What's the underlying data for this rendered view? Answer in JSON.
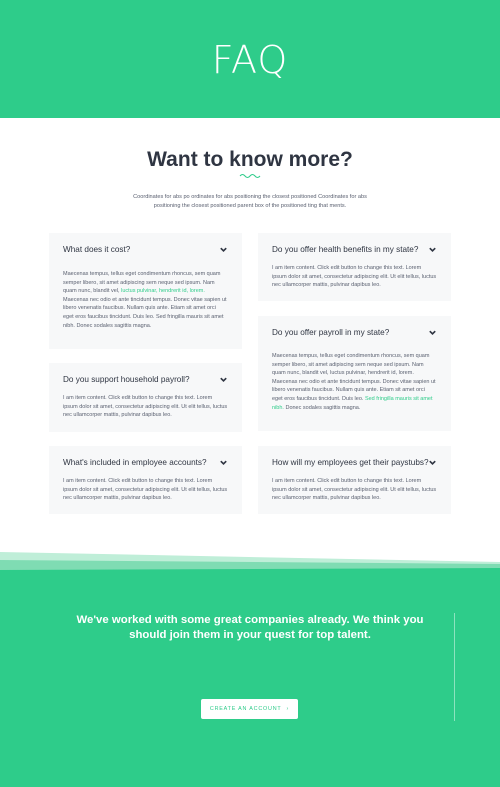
{
  "hero": {
    "title": "FAQ"
  },
  "intro": {
    "heading": "Want to know more?",
    "text": "Coordinates for abs po ordinates for abs positioning the closest positioned Coordinates for abs positioning the closest positioned parent box of the positioned ting that ments."
  },
  "faqs": [
    {
      "question": "What does it cost?",
      "text_before_link": "Maecenas tempus, tellus eget condimentum rhoncus, sem quam semper libero, sit amet adipiscing sem neque sed ipsum. Nam quam nunc, blandit vel, ",
      "link": "luctus pulvinar, hendrerit id, lorem.",
      "text_after_link": " Maecenas nec odio et ante tincidunt tempus. Donec vitae sapien ut libero venenatis faucibus. Nullam quis ante. Etiam sit amet orci eget eros faucibus tincidunt. Duis leo. Sed fringilla mauris sit amet nibh. Donec sodales sagittis magna."
    },
    {
      "question": "Do you offer health benefits in my state?",
      "text_before_link": "I am item content. Click edit button to change this text. Lorem ipsum dolor sit amet, consectetur adipiscing elit. Ut elit tellus, luctus nec ullamcorper mattis, pulvinar dapibus leo.",
      "link": "",
      "text_after_link": ""
    },
    {
      "question": "Do you offer payroll in my state?",
      "text_before_link": "Maecenas tempus, tellus eget condimentum rhoncus, sem quam semper libero, sit amet adipiscing sem neque sed ipsum. Nam quam nunc, blandit vel, luctus pulvinar, hendrerit id, lorem. Maecenas nec odio et ante tincidunt tempus. Donec vitae sapien ut libero venenatis faucibus. Nullam quis ante. Etiam sit amet orci eget eros faucibus tincidunt. Duis leo. ",
      "link": "Sed fringilla mauris sit amet nibh.",
      "text_after_link": " Donec sodales sagittis magna."
    },
    {
      "question": "Do you support household payroll?",
      "text_before_link": "I am item content. Click edit button to change this text. Lorem ipsum dolor sit amet, consectetur adipiscing elit. Ut elit tellus, luctus nec ullamcorper mattis, pulvinar dapibus leo.",
      "link": "",
      "text_after_link": ""
    },
    {
      "question": "What's included in employee accounts?",
      "text_before_link": "I am item content. Click edit button to change this text. Lorem ipsum dolor sit amet, consectetur adipiscing elit. Ut elit tellus, luctus nec ullamcorper mattis, pulvinar dapibus leo.",
      "link": "",
      "text_after_link": ""
    },
    {
      "question": "How will my employees get their paystubs?",
      "text_before_link": "I am item content. Click edit button to change this text. Lorem ipsum dolor sit amet, consectetur adipiscing elit. Ut elit tellus, luctus nec ullamcorper mattis, pulvinar dapibus leo.",
      "link": "",
      "text_after_link": ""
    }
  ],
  "cta": {
    "text": "We've worked with some great companies already. We think you should join them in your quest for top talent.",
    "button_label": "CREATE AN ACCOUNT",
    "button_arrow": "›"
  },
  "icons": {
    "chevron": "chevron-down-icon",
    "wave": "wave-divider-icon",
    "arrow": "arrow-right-icon"
  },
  "colors": {
    "brand": "#2ecc8a",
    "card": "#f7f8f9",
    "heading": "#2f3542",
    "text": "#5a6070",
    "white": "#ffffff"
  }
}
